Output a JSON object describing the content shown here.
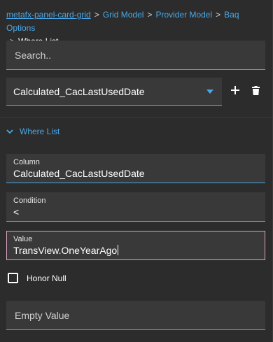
{
  "breadcrumb": {
    "items": [
      {
        "label": "metafx-panel-card-grid"
      },
      {
        "label": "Grid Model"
      },
      {
        "label": "Provider Model"
      },
      {
        "label": "Baq Options"
      }
    ],
    "separator": ">",
    "current": "Where List"
  },
  "search": {
    "placeholder": "Search..",
    "value": ""
  },
  "where_select": {
    "selected": "Calculated_CacLastUsedDate",
    "add_icon": "plus-icon",
    "delete_icon": "trash-icon"
  },
  "section": {
    "title": "Where List",
    "icon": "chevron-down-icon",
    "expanded": true
  },
  "fields": {
    "column": {
      "label": "Column",
      "value": "Calculated_CacLastUsedDate"
    },
    "condition": {
      "label": "Condition",
      "value": "<"
    },
    "value": {
      "label": "Value",
      "value": "TransView.OneYearAgo"
    }
  },
  "honor_null": {
    "label": "Honor Null",
    "checked": false
  },
  "empty_value": {
    "placeholder": "Empty Value",
    "value": ""
  },
  "colors": {
    "accent": "#4aa8e8",
    "background": "#2c2c2c",
    "field_bg": "#393939",
    "focus_border": "#d9a4bf"
  }
}
